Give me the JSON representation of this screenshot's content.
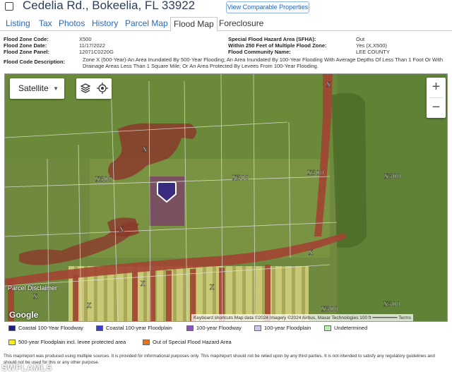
{
  "header": {
    "address": "Cedelia Rd., Bokeelia, FL 33922",
    "view_comparable": "View Comparable Properties"
  },
  "tabs": [
    {
      "label": "Listing"
    },
    {
      "label": "Tax"
    },
    {
      "label": "Photos"
    },
    {
      "label": "History"
    },
    {
      "label": "Parcel Map"
    },
    {
      "label": "Flood Map"
    },
    {
      "label": "Foreclosure"
    }
  ],
  "info": {
    "flood_zone_code_label": "Flood Zone Code:",
    "flood_zone_code": "X500",
    "flood_zone_date_label": "Flood Zone Date:",
    "flood_zone_date": "11/17/2022",
    "flood_zone_panel_label": "Flood Zone Panel:",
    "flood_zone_panel": "12071C0220G",
    "sfha_label": "Special Flood Hazard Area (SFHA):",
    "sfha": "Out",
    "within_250_label": "Within 250 Feet of Multiple Flood Zone:",
    "within_250": "Yes (X,X500)",
    "community_label": "Flood Community Name:",
    "community": "LEE COUNTY",
    "description_label": "Flood Code Description:",
    "description": "Zone X (500-Year)-An Area Inundated By 500-Year Flooding; An Area Inundated By 100-Year Flooding With Average Depths Of Less Than 1 Foot Or With Drainage Areas Less Than 1 Square Mile; Or An Area Protected By Levees From 100-Year Flooding."
  },
  "map": {
    "layer_select": "Satellite",
    "zoom_in": "+",
    "zoom_out": "−",
    "parcel_disclaimer": "Parcel Disclaimer",
    "google": "Google",
    "credits": "Keyboard shortcuts   Map data ©2024 Imagery ©2024 Airbus, Maxar Technologies   100 ft ━━━━━━━━━   Terms",
    "zone_labels": [
      "X",
      "X",
      "X500",
      "X500",
      "X500",
      "X500",
      "X",
      "X",
      "X",
      "X",
      "X",
      "X500",
      "X500",
      "X"
    ]
  },
  "legend": [
    {
      "label": "Coastal 100-Year Floodway",
      "color": "#1c1c8a"
    },
    {
      "label": "Coastal 100-year Floodplain",
      "color": "#3b3bd6"
    },
    {
      "label": "100-year Floodway",
      "color": "#8a52c8"
    },
    {
      "label": "100-year Floodplain",
      "color": "#d2c2ec"
    },
    {
      "label": "Undetermined",
      "color": "#b8efb0"
    },
    {
      "label": "500-year Floodplain incl. levee protected area",
      "color": "#f5f01a"
    },
    {
      "label": "Out of Special Flood Hazard Area",
      "color": "#e8741e"
    }
  ],
  "footer": "This map/report was produced using multiple sources. It is provided for informational purposes only. This map/report should not be relied upon by any third parties. It is not intended to satisfy any regulatory guidelines and should not be used for this or any other purpose.",
  "watermark": "SWFLAMLS"
}
